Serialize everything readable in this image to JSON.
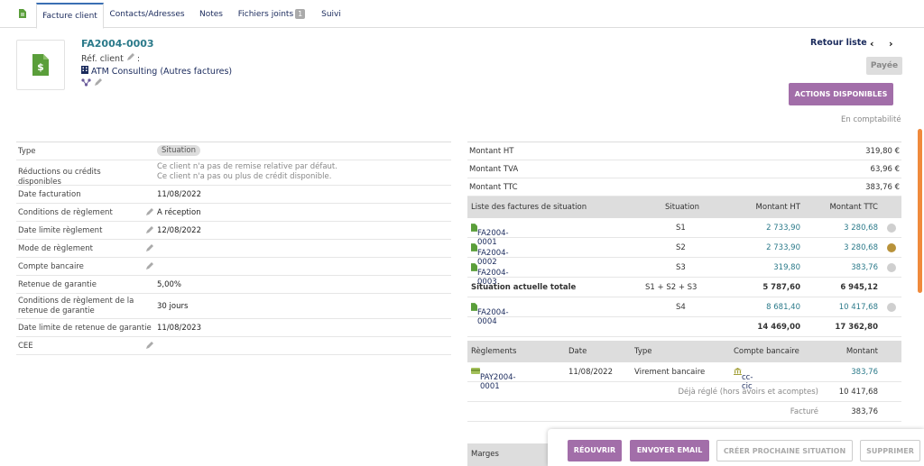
{
  "tabs": [
    {
      "label": "Facture client"
    },
    {
      "label": "Contacts/Adresses"
    },
    {
      "label": "Notes"
    },
    {
      "label": "Fichiers joints",
      "badge": "1"
    },
    {
      "label": "Suivi"
    }
  ],
  "header": {
    "ref": "FA2004-0003",
    "ref_client_label": "Réf. client",
    "ref_client_sep": " :",
    "company": "ATM Consulting",
    "company_suffix": "(Autres factures)",
    "retour": "Retour liste",
    "prev": "‹",
    "next": "›",
    "status": "Payée",
    "actions": "ACTIONS DISPONIBLES",
    "compta": "En comptabilité"
  },
  "left": {
    "type_label": "Type",
    "type_value": "Situation",
    "reductions_label": "Réductions ou crédits disponibles",
    "reductions_line1": "Ce client n'a pas de remise relative par défaut.",
    "reductions_line2": "Ce client n'a pas ou plus de crédit disponible.",
    "date_fact_label": "Date facturation",
    "date_fact_value": "11/08/2022",
    "cond_label": "Conditions de règlement",
    "cond_value": "A réception",
    "date_lim_label": "Date limite règlement",
    "date_lim_value": "12/08/2022",
    "mode_label": "Mode de règlement",
    "compte_label": "Compte bancaire",
    "retenue_label": "Retenue de garantie",
    "retenue_value": "5,00%",
    "cond_ret_label": "Conditions de règlement de la retenue de garantie",
    "cond_ret_value": "30 jours",
    "date_ret_label": "Date limite de retenue de garantie",
    "date_ret_value": "11/08/2023",
    "cee_label": "CEE"
  },
  "amounts": {
    "ht_label": "Montant HT",
    "ht_value": "319,80 €",
    "tva_label": "Montant TVA",
    "tva_value": "63,96 €",
    "ttc_label": "Montant TTC",
    "ttc_value": "383,76 €"
  },
  "situations": {
    "headers": {
      "list": "Liste des factures de situation",
      "situation": "Situation",
      "ht": "Montant HT",
      "ttc": "Montant TTC"
    },
    "rows": [
      {
        "ref": "FA2004-0001",
        "situation": "S1",
        "ht": "2 733,90",
        "ttc": "3 280,68",
        "dot": "#cfcfcf"
      },
      {
        "ref": "FA2004-0002",
        "situation": "S2",
        "ht": "2 733,90",
        "ttc": "3 280,68",
        "dot": "#b8923a"
      },
      {
        "ref": "FA2004-0003",
        "situation": "S3",
        "ht": "319,80",
        "ttc": "383,76",
        "dot": "#cfcfcf"
      }
    ],
    "total": {
      "label": "Situation actuelle totale",
      "situation": "S1 + S2 + S3",
      "ht": "5 787,60",
      "ttc": "6 945,12"
    },
    "next": {
      "ref": "FA2004-0004",
      "situation": "S4",
      "ht": "8 681,40",
      "ttc": "10 417,68",
      "dot": "#cfcfcf"
    },
    "grand": {
      "ht": "14 469,00",
      "ttc": "17 362,80"
    }
  },
  "payments": {
    "headers": {
      "ref": "Règlements",
      "date": "Date",
      "type": "Type",
      "account": "Compte bancaire",
      "amount": "Montant"
    },
    "row": {
      "ref": "PAY2004-0001",
      "date": "11/08/2022",
      "type": "Virement bancaire",
      "account": "cc-cic",
      "amount": "383,76"
    },
    "deja_label": "Déjà réglé (hors avoirs et acomptes)",
    "deja_value": "10 417,68",
    "facture_label": "Facturé",
    "facture_value": "383,76"
  },
  "marges_label": "Marges",
  "buttons": {
    "reopen": "RÉOUVRIR",
    "email": "ENVOYER EMAIL",
    "next_sit": "CRÉER PROCHAINE SITUATION",
    "delete": "SUPPRIMER"
  },
  "colors": {
    "accent": "#a26ea9",
    "link": "#1a2a5c",
    "teal": "#2b7a8a",
    "icon_green": "#5a9e3a"
  },
  "icons": [
    "invoice-icon",
    "pencil-icon",
    "building-icon",
    "project-icon",
    "bank-icon",
    "payment-icon"
  ]
}
